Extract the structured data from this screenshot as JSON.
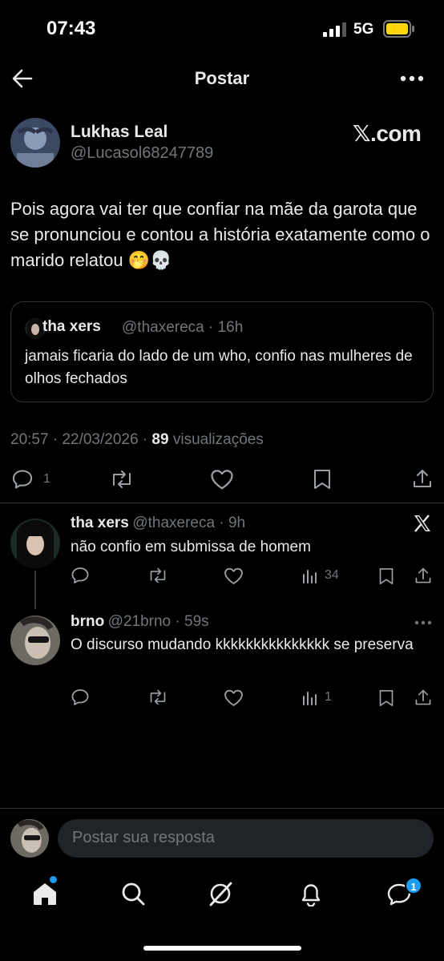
{
  "status_bar": {
    "time": "07:43",
    "network": "5G",
    "battery_color": "#ffd60a"
  },
  "header": {
    "title": "Postar",
    "back_icon": "arrow-left-icon",
    "more_icon": "more-horizontal-icon"
  },
  "post": {
    "author_name": "Lukhas Leal",
    "author_handle": "@Lucasol68247789",
    "watermark": "𝕏.com",
    "text": "Pois agora vai ter que confiar na mãe da garota que se pronunciou e contou a história exatamente como o marido relatou 🤭💀",
    "quote": {
      "name": "tha xers",
      "meta": "@thaxereca · 16h",
      "text": "jamais ficaria do lado de um who, confio nas mulheres de olhos fechados"
    },
    "timestamp": "20:57 · 22/03/2026 · ",
    "views_count": "89",
    "views_label": " visualizações",
    "actions": {
      "replies": "1"
    }
  },
  "replies": [
    {
      "name": "tha xers",
      "meta": "@thaxereca · 9h",
      "text": "não confio em submissa de homem",
      "views": "34"
    },
    {
      "name": "brno",
      "meta": "@21brno · 59s",
      "text": "O discurso mudando kkkkkkkkkkkkkkk se preserva",
      "views": "1"
    }
  ],
  "composer": {
    "placeholder": "Postar sua resposta"
  },
  "tabbar": {
    "icons": [
      "home-icon",
      "search-icon",
      "grok-icon",
      "notifications-icon",
      "messages-icon"
    ],
    "messages_badge": "1"
  },
  "colors": {
    "accent": "#1d9bf0",
    "text": "#e7e9ea",
    "muted": "#71767b",
    "border": "#2f3336"
  }
}
